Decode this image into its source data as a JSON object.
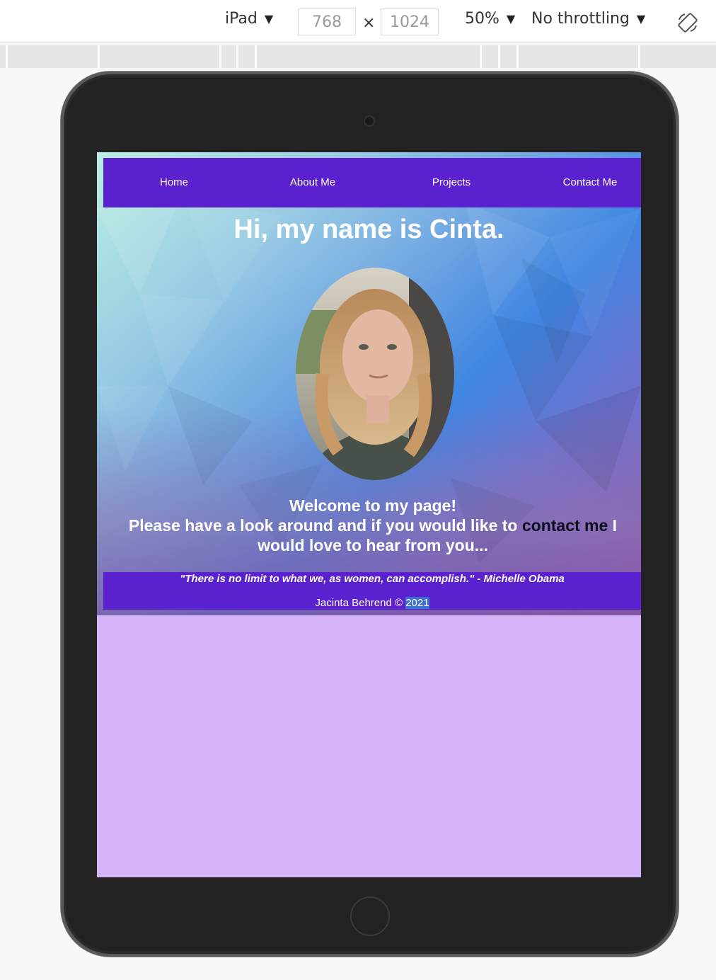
{
  "devtools": {
    "device": "iPad",
    "width": "768",
    "times": "×",
    "height": "1024",
    "zoom": "50%",
    "throttling": "No throttling",
    "caret": "▼"
  },
  "site": {
    "nav": {
      "home": "Home",
      "about": "About Me",
      "projects": "Projects",
      "contact": "Contact Me"
    },
    "title": "Hi, my name is Cinta.",
    "welcome": {
      "line1": "Welcome to my page!",
      "pre_link": "Please have a look around and if you would like to ",
      "link": "contact me",
      "post_link": " I would love to hear from you..."
    },
    "footer": {
      "quote": "\"There is no limit to what we, as women, can accomplish.\" - Michelle Obama",
      "copyright_name": "Jacinta Behrend ©",
      "copyright_year": "2021"
    }
  },
  "colors": {
    "nav_bg": "#5c21cf",
    "page_bg": "#d5b4fa",
    "link_text": "#0d0d1e"
  },
  "icons": {
    "rotate": "rotate-device-icon",
    "camera": "camera-icon",
    "home_button": "home-button-icon"
  }
}
